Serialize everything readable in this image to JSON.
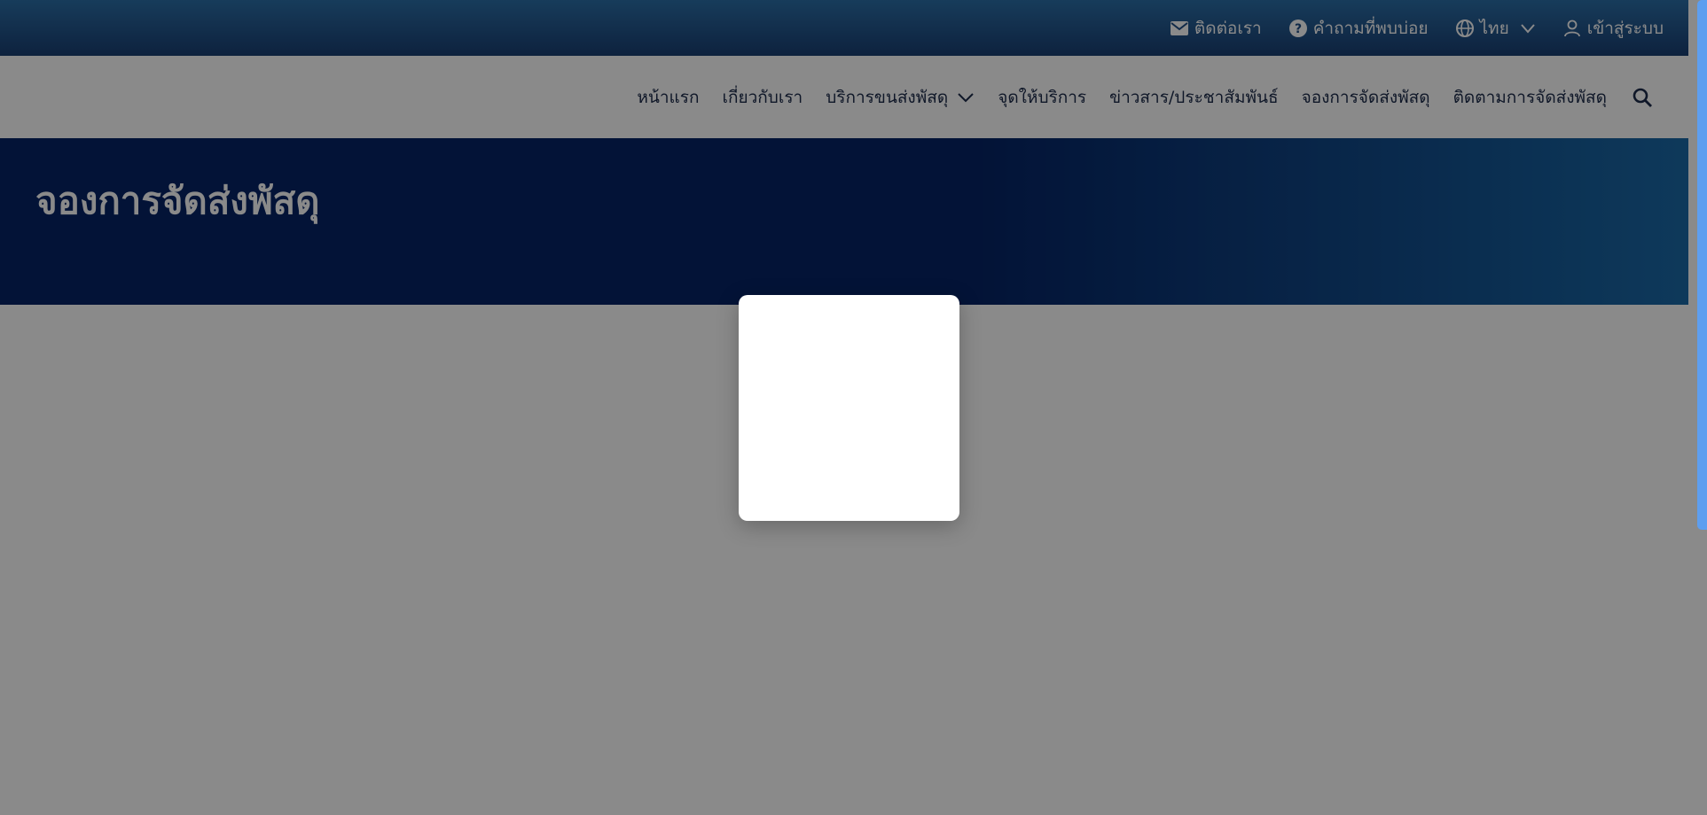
{
  "topbar": {
    "contact_label": "ติดต่อเรา",
    "faq_label": "คำถามที่พบบ่อย",
    "language_label": "ไทย",
    "login_label": "เข้าสู่ระบบ"
  },
  "nav": {
    "items": [
      {
        "label": "หน้าแรก"
      },
      {
        "label": "เกี่ยวกับเรา"
      },
      {
        "label": "บริการขนส่งพัสดุ"
      },
      {
        "label": "จุดให้บริการ"
      },
      {
        "label": "ข่าวสาร/ประชาสัมพันธ์"
      },
      {
        "label": "จองการจัดส่งพัสดุ"
      },
      {
        "label": "ติดตามการจัดส่งพัสดุ"
      }
    ]
  },
  "hero": {
    "title": "จองการจัดส่งพัสดุ"
  },
  "colors": {
    "topbar_start": "#2b6fa8",
    "hero_dark": "#062466",
    "hero_light": "#1a6aa8",
    "overlay": "rgba(0,0,0,0.46)",
    "scroll_thumb": "#5d9ef0"
  },
  "icons": {
    "contact": "envelope-icon",
    "faq": "question-circle-icon",
    "language": "globe-icon",
    "login": "user-icon",
    "search": "search-icon"
  }
}
